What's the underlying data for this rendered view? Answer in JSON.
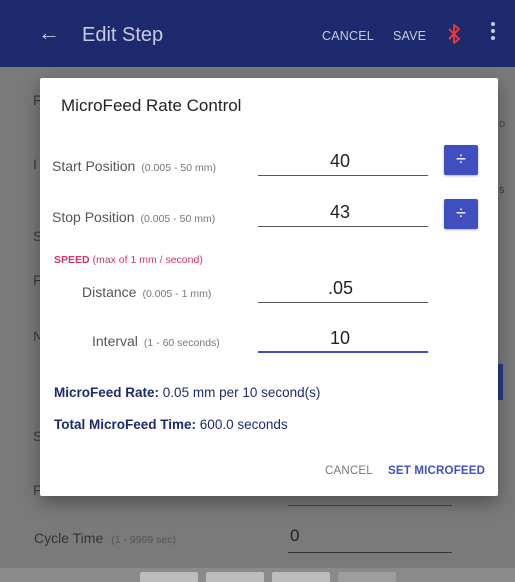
{
  "appbar": {
    "back_icon": "arrow-left-icon",
    "title": "Edit Step",
    "cancel": "CANCEL",
    "save": "SAVE",
    "bluetooth_icon": "bluetooth-icon",
    "overflow_icon": "more-vert-icon",
    "color": "#1e2a6e"
  },
  "background_form": {
    "cycle_time_label": "Cycle Time",
    "cycle_time_hint": "(1 - 9999 sec)",
    "cycle_time_value": "0",
    "edge_letters": [
      "F",
      "I",
      "S",
      "F",
      "N",
      "S",
      "F"
    ],
    "right_edge_frags": [
      "o",
      "s"
    ]
  },
  "dialog": {
    "title": "MicroFeed Rate Control",
    "start": {
      "label": "Start Position",
      "range": "(0.005 - 50 mm)",
      "value": "40",
      "calc_icon": "calculator-icon"
    },
    "stop": {
      "label": "Stop Position",
      "range": "(0.005 - 50 mm)",
      "value": "43",
      "calc_icon": "calculator-icon"
    },
    "speed": {
      "label": "SPEED",
      "hint": "(max of 1 mm / second)"
    },
    "distance": {
      "label": "Distance",
      "range": "(0.005 - 1 mm)",
      "value": ".05"
    },
    "interval": {
      "label": "Interval",
      "range": "(1 - 60 seconds)",
      "value": "10"
    },
    "rate": {
      "label": "MicroFeed Rate:",
      "text": "0.05 mm per 10 second(s)"
    },
    "total": {
      "label": "Total MicroFeed Time:",
      "text": "600.0 seconds"
    },
    "cancel": "CANCEL",
    "set": "SET MICROFEED",
    "accent": "#3f4fbf",
    "speed_color": "#d6336c"
  }
}
